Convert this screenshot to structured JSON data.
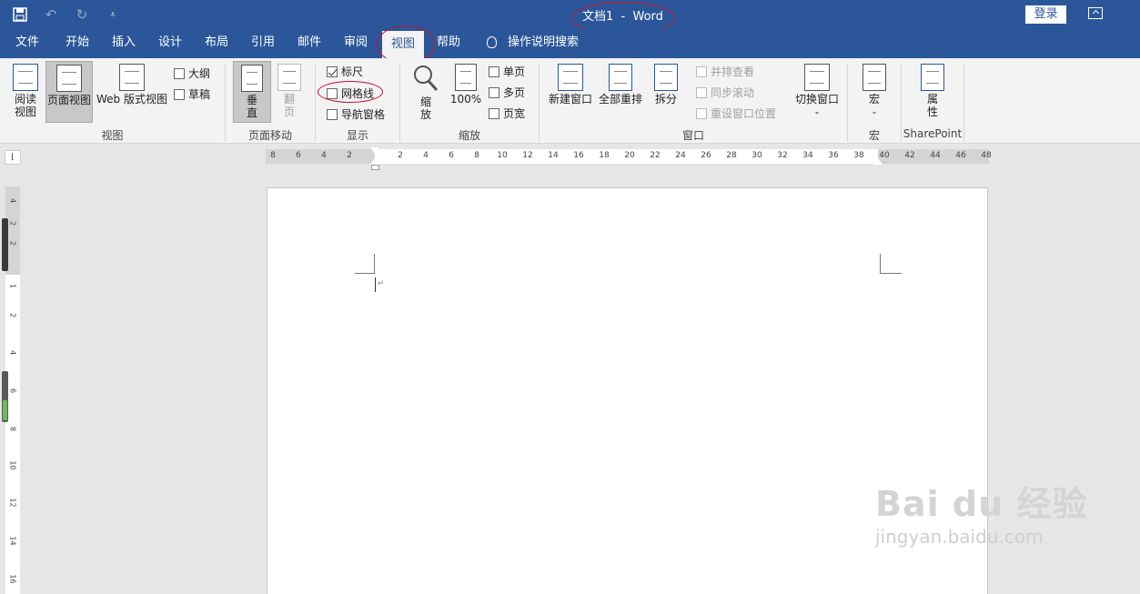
{
  "window": {
    "title": "文档1  -  Word",
    "login_label": "登录",
    "colors": {
      "brand": "#2b579a",
      "annotation": "#c8102e"
    }
  },
  "qat": {
    "icons": [
      "save-icon",
      "undo-icon",
      "redo-icon",
      "customize-icon"
    ]
  },
  "tabs": [
    {
      "label": "文件"
    },
    {
      "label": "开始"
    },
    {
      "label": "插入"
    },
    {
      "label": "设计"
    },
    {
      "label": "布局"
    },
    {
      "label": "引用"
    },
    {
      "label": "邮件"
    },
    {
      "label": "审阅"
    },
    {
      "label": "视图",
      "active": true
    },
    {
      "label": "帮助"
    }
  ],
  "tell_me": "操作说明搜索",
  "ribbon": {
    "views": {
      "group_label": "视图",
      "read_mode": "阅读\n视图",
      "print_layout": "页面视图",
      "web_layout": "Web 版式视图",
      "outline": "大纲",
      "draft": "草稿"
    },
    "page_movement": {
      "group_label": "页面移动",
      "vertical": "垂\n直",
      "side_to_side": "翻\n页"
    },
    "show": {
      "group_label": "显示",
      "ruler": "标尺",
      "ruler_checked": true,
      "gridlines": "网格线",
      "gridlines_checked": false,
      "nav_pane": "导航窗格",
      "nav_pane_checked": false
    },
    "zoom": {
      "group_label": "缩放",
      "zoom": "缩\n放",
      "hundred": "100%",
      "one_page": "单页",
      "multiple_pages": "多页",
      "page_width": "页宽"
    },
    "window": {
      "group_label": "窗口",
      "new_window": "新建窗口",
      "arrange_all": "全部重排",
      "split": "拆分",
      "side_by_side": "并排查看",
      "sync_scroll": "同步滚动",
      "reset_position": "重设窗口位置",
      "switch_windows": "切换窗口"
    },
    "macros": {
      "group_label": "宏",
      "macros": "宏"
    },
    "sharepoint": {
      "group_label": "SharePoint",
      "properties": "属\n性"
    }
  },
  "ruler": {
    "h_ticks_left": [
      "8",
      "6",
      "4",
      "2"
    ],
    "h_ticks_right": [
      "2",
      "4",
      "6",
      "8",
      "10",
      "12",
      "14",
      "16",
      "18",
      "20",
      "22",
      "24",
      "26",
      "28",
      "30",
      "32",
      "34",
      "36",
      "38",
      "40",
      "42",
      "44",
      "46",
      "48"
    ],
    "v_ticks": [
      "4",
      "2",
      "2",
      "1",
      "2",
      "4",
      "6",
      "8",
      "10",
      "12",
      "14",
      "16"
    ]
  },
  "watermark": {
    "brand": "Bai du 经验",
    "url": "jingyan.baidu.com"
  }
}
